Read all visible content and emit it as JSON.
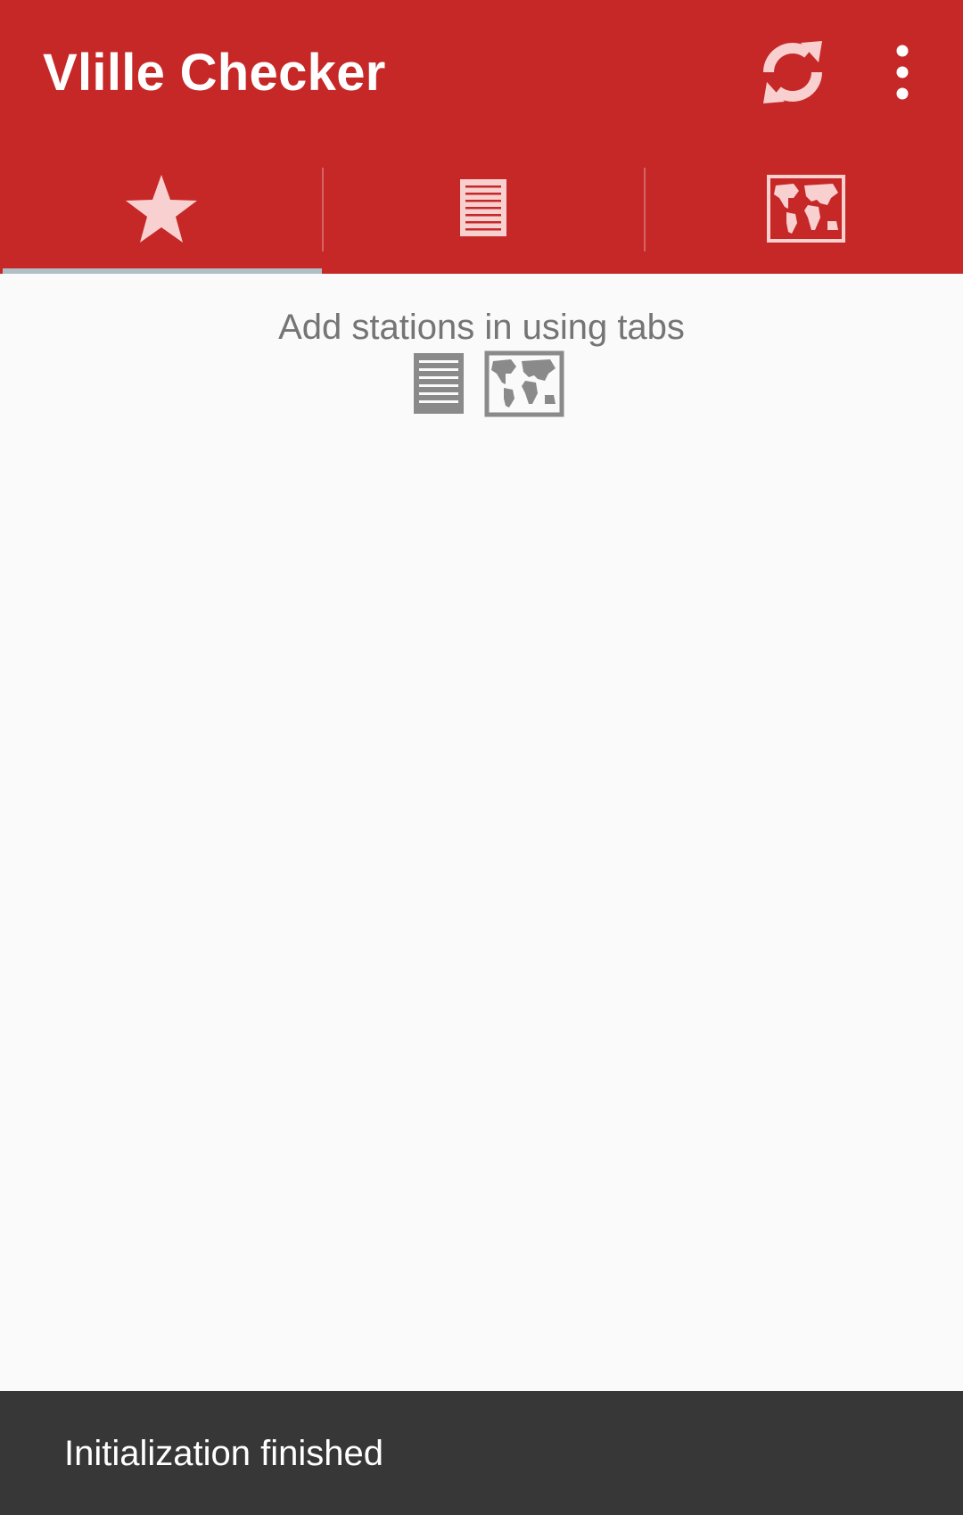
{
  "app": {
    "title": "Vlille Checker"
  },
  "toolbar": {
    "actions": [
      {
        "name": "refresh",
        "icon": "refresh-icon"
      },
      {
        "name": "overflow-menu",
        "icon": "more-vert-icon"
      }
    ]
  },
  "tabs": [
    {
      "id": "favorites",
      "icon": "star-icon",
      "selected": true
    },
    {
      "id": "list",
      "icon": "list-icon",
      "selected": false
    },
    {
      "id": "map",
      "icon": "map-icon",
      "selected": false
    }
  ],
  "empty_state": {
    "message": "Add stations in using tabs",
    "icons": [
      "list-icon",
      "map-icon"
    ]
  },
  "snackbar": {
    "message": "Initialization finished"
  },
  "colors": {
    "primary": "#c62828",
    "tab_icon": "#f8d0d0",
    "tab_indicator": "#b0bec5",
    "background": "#fafafa",
    "message_text": "#757575",
    "hint_icon": "#8a8a8a",
    "snackbar_bg": "#373737",
    "snackbar_text": "#ffffff"
  }
}
